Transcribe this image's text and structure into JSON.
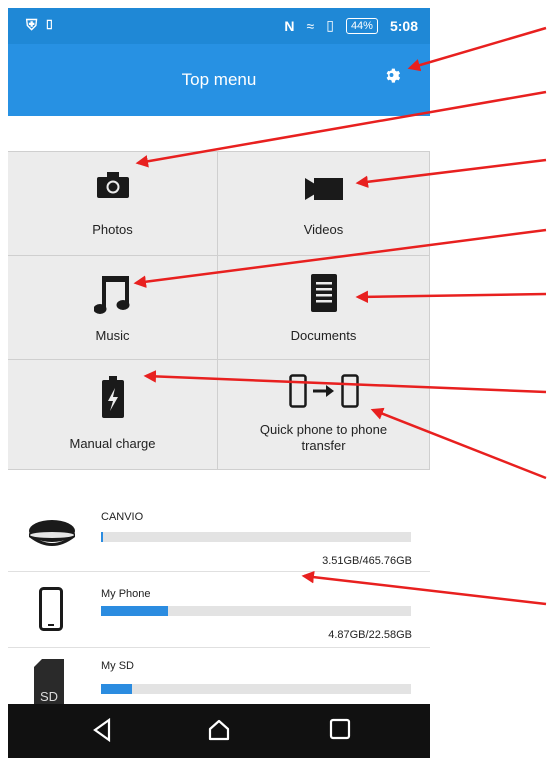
{
  "status_bar": {
    "battery": "44%",
    "time": "5:08"
  },
  "top_menu": {
    "title": "Top menu",
    "settings_icon": "gear-icon"
  },
  "tiles": [
    {
      "label": "Photos",
      "icon": "camera-icon"
    },
    {
      "label": "Videos",
      "icon": "video-camera-icon"
    },
    {
      "label": "Music",
      "icon": "music-note-icon"
    },
    {
      "label": "Documents",
      "icon": "document-icon"
    },
    {
      "label": "Manual charge",
      "icon": "battery-charge-icon"
    },
    {
      "label": "Quick phone to phone transfer",
      "icon": "phone-transfer-icon"
    }
  ],
  "storage": [
    {
      "name": "CANVIO",
      "capacity": "3.51GB/465.76GB",
      "used_fraction": 0.008,
      "icon": "external-drive-icon"
    },
    {
      "name": "My Phone",
      "capacity": "4.87GB/22.58GB",
      "used_fraction": 0.216,
      "icon": "phone-icon"
    },
    {
      "name": "My SD",
      "capacity": "",
      "used_fraction": 0.1,
      "icon": "sd-card-icon"
    }
  ],
  "colors": {
    "accent": "#2791e3",
    "status_bar": "#1f88d6",
    "annotation_arrow": "#e8201f",
    "tile_bg": "#ececec"
  }
}
